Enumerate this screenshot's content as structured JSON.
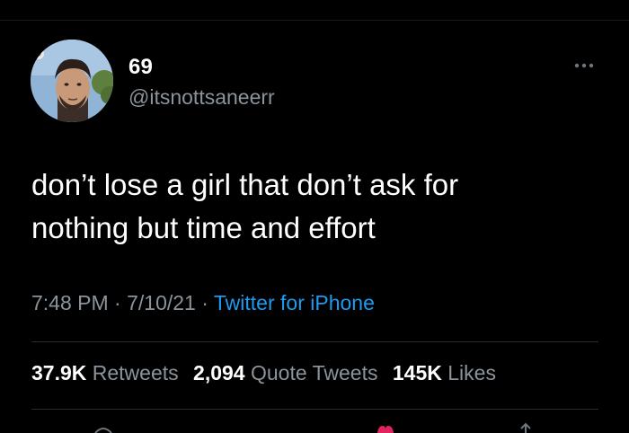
{
  "tweet": {
    "display_name": "69",
    "handle": "@itsnottsaneerr",
    "text_line1": "don’t lose a girl that don’t ask for",
    "text_line2": "nothing but time and effort",
    "time": "7:48 PM",
    "separator": "·",
    "date": "7/10/21",
    "source": "Twitter for iPhone"
  },
  "stats": {
    "retweets_count": "37.9K",
    "retweets_label": "Retweets",
    "quotes_count": "2,094",
    "quotes_label": "Quote Tweets",
    "likes_count": "145K",
    "likes_label": "Likes"
  },
  "icons": {
    "avatar": "profile-photo",
    "more": "more-options-icon",
    "reply": "reply-icon",
    "like": "heart-icon",
    "share": "share-icon"
  },
  "colors": {
    "background": "#000000",
    "text": "#ffffff",
    "secondary_text": "#8b939b",
    "link": "#1d9bf0"
  }
}
